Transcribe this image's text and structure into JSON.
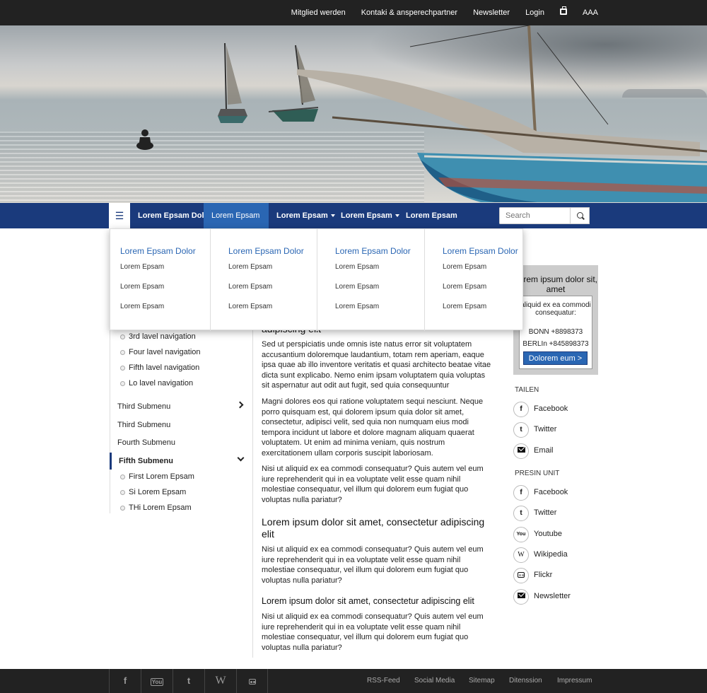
{
  "topbar": {
    "links": [
      "Mitglied werden",
      "Kontaki & ansperechpartner",
      "Newsletter",
      "Login"
    ],
    "font_size_label": "AAA"
  },
  "nav": {
    "items": [
      "Lorem Epsam Dolo",
      "Lorem Epsam",
      "Lorem Epsam",
      "Lorem Epsam",
      "Lorem Epsam"
    ],
    "search_placeholder": "Search"
  },
  "mega": {
    "columns": [
      {
        "title": "Lorem Epsam Dolor",
        "links": [
          "Lorem Epsam",
          "Lorem Epsam",
          "Lorem Epsam"
        ]
      },
      {
        "title": "Lorem Epsam Dolor",
        "links": [
          "Lorem Epsam",
          "Lorem Epsam",
          "Lorem Epsam"
        ]
      },
      {
        "title": "Lorem Epsam Dolor",
        "links": [
          "Lorem Epsam",
          "Lorem Epsam",
          "Lorem Epsam"
        ]
      },
      {
        "title": "Lorem Epsam Dolor",
        "links": [
          "Lorem Epsam",
          "Lorem Epsam",
          "Lorem Epsam"
        ]
      }
    ]
  },
  "sidebar": {
    "levels": [
      "3rd lavel navigation",
      "Four lavel navigation",
      "Fifth lavel navigation",
      "Lo lavel navigation"
    ],
    "submenus": [
      "Third Submenu",
      "Third Submenu",
      "Fourth Submenu",
      "Fifth Submenu"
    ],
    "children": [
      "First Lorem Epsam",
      "Si Lorem Epsam",
      "THi Lorem Epsam"
    ]
  },
  "content": {
    "heading1_fragment": "adipiscing elit",
    "p1": "Sed ut perspiciatis unde omnis iste natus error sit voluptatem accusantium doloremque laudantium, totam rem aperiam, eaque ipsa quae ab illo inventore veritatis et quasi architecto beatae vitae dicta sunt explicabo. Nemo enim ipsam voluptatem quia voluptas sit aspernatur aut odit aut fugit, sed quia consequuntur",
    "p2": "Magni dolores eos qui ratione voluptatem sequi nesciunt. Neque porro quisquam est, qui dolorem ipsum quia dolor sit amet, consectetur, adipisci velit, sed quia non numquam eius modi tempora incidunt ut labore et dolore magnam aliquam quaerat voluptatem. Ut enim ad minima veniam, quis nostrum exercitationem ullam corporis suscipit laboriosam.",
    "p3": "Nisi ut aliquid ex ea commodi consequatur? Quis autem vel eum iure reprehenderit qui in ea voluptate velit esse quam nihil molestiae consequatur, vel illum qui dolorem eum fugiat quo voluptas nulla pariatur?",
    "heading2": "Lorem ipsum dolor sit amet, consectetur adipiscing elit",
    "p4": "Nisi ut aliquid ex ea commodi consequatur? Quis autem vel eum iure reprehenderit qui in ea voluptate velit esse quam nihil molestiae consequatur, vel illum qui dolorem eum fugiat quo voluptas nulla pariatur?",
    "heading3": "Lorem ipsum dolor sit amet, consectetur adipiscing elit",
    "p5": "Nisi ut aliquid ex ea commodi consequatur? Quis autem vel eum iure reprehenderit qui in ea voluptate velit esse quam nihil molestiae consequatur, vel illum qui dolorem eum fugiat quo voluptas nulla pariatur?"
  },
  "contact": {
    "title": "Lorem ipsum dolor sit, amet",
    "desc": "aliquid ex ea commodi consequatur:",
    "bonn": "BONN +8898373",
    "berlin": "BERLIn +845898373",
    "button": "Dolorem eum >"
  },
  "share": {
    "title": "TAILEN",
    "items": [
      {
        "icon": "f",
        "label": "Facebook"
      },
      {
        "icon": "t",
        "label": "Twitter"
      },
      {
        "icon": "mail",
        "label": "Email"
      }
    ]
  },
  "press": {
    "title": "PRESIN UNIT",
    "items": [
      {
        "icon": "f",
        "label": "Facebook"
      },
      {
        "icon": "t",
        "label": "Twitter"
      },
      {
        "icon": "yt",
        "label": "Youtube"
      },
      {
        "icon": "W",
        "label": "Wikipedia"
      },
      {
        "icon": "fl",
        "label": "Flickr"
      },
      {
        "icon": "mail",
        "label": "Newsletter"
      }
    ]
  },
  "footer": {
    "icon_glyphs": {
      "facebook": "f",
      "youtube": "You",
      "twitter": "t",
      "wikipedia": "W"
    },
    "links": [
      "RSS-Feed",
      "Social Media",
      "Sitemap",
      "Ditenssion",
      "Impressum"
    ]
  },
  "colors": {
    "nav": "#1a3a7c",
    "accent": "#2a66b3",
    "dark": "#222222"
  }
}
